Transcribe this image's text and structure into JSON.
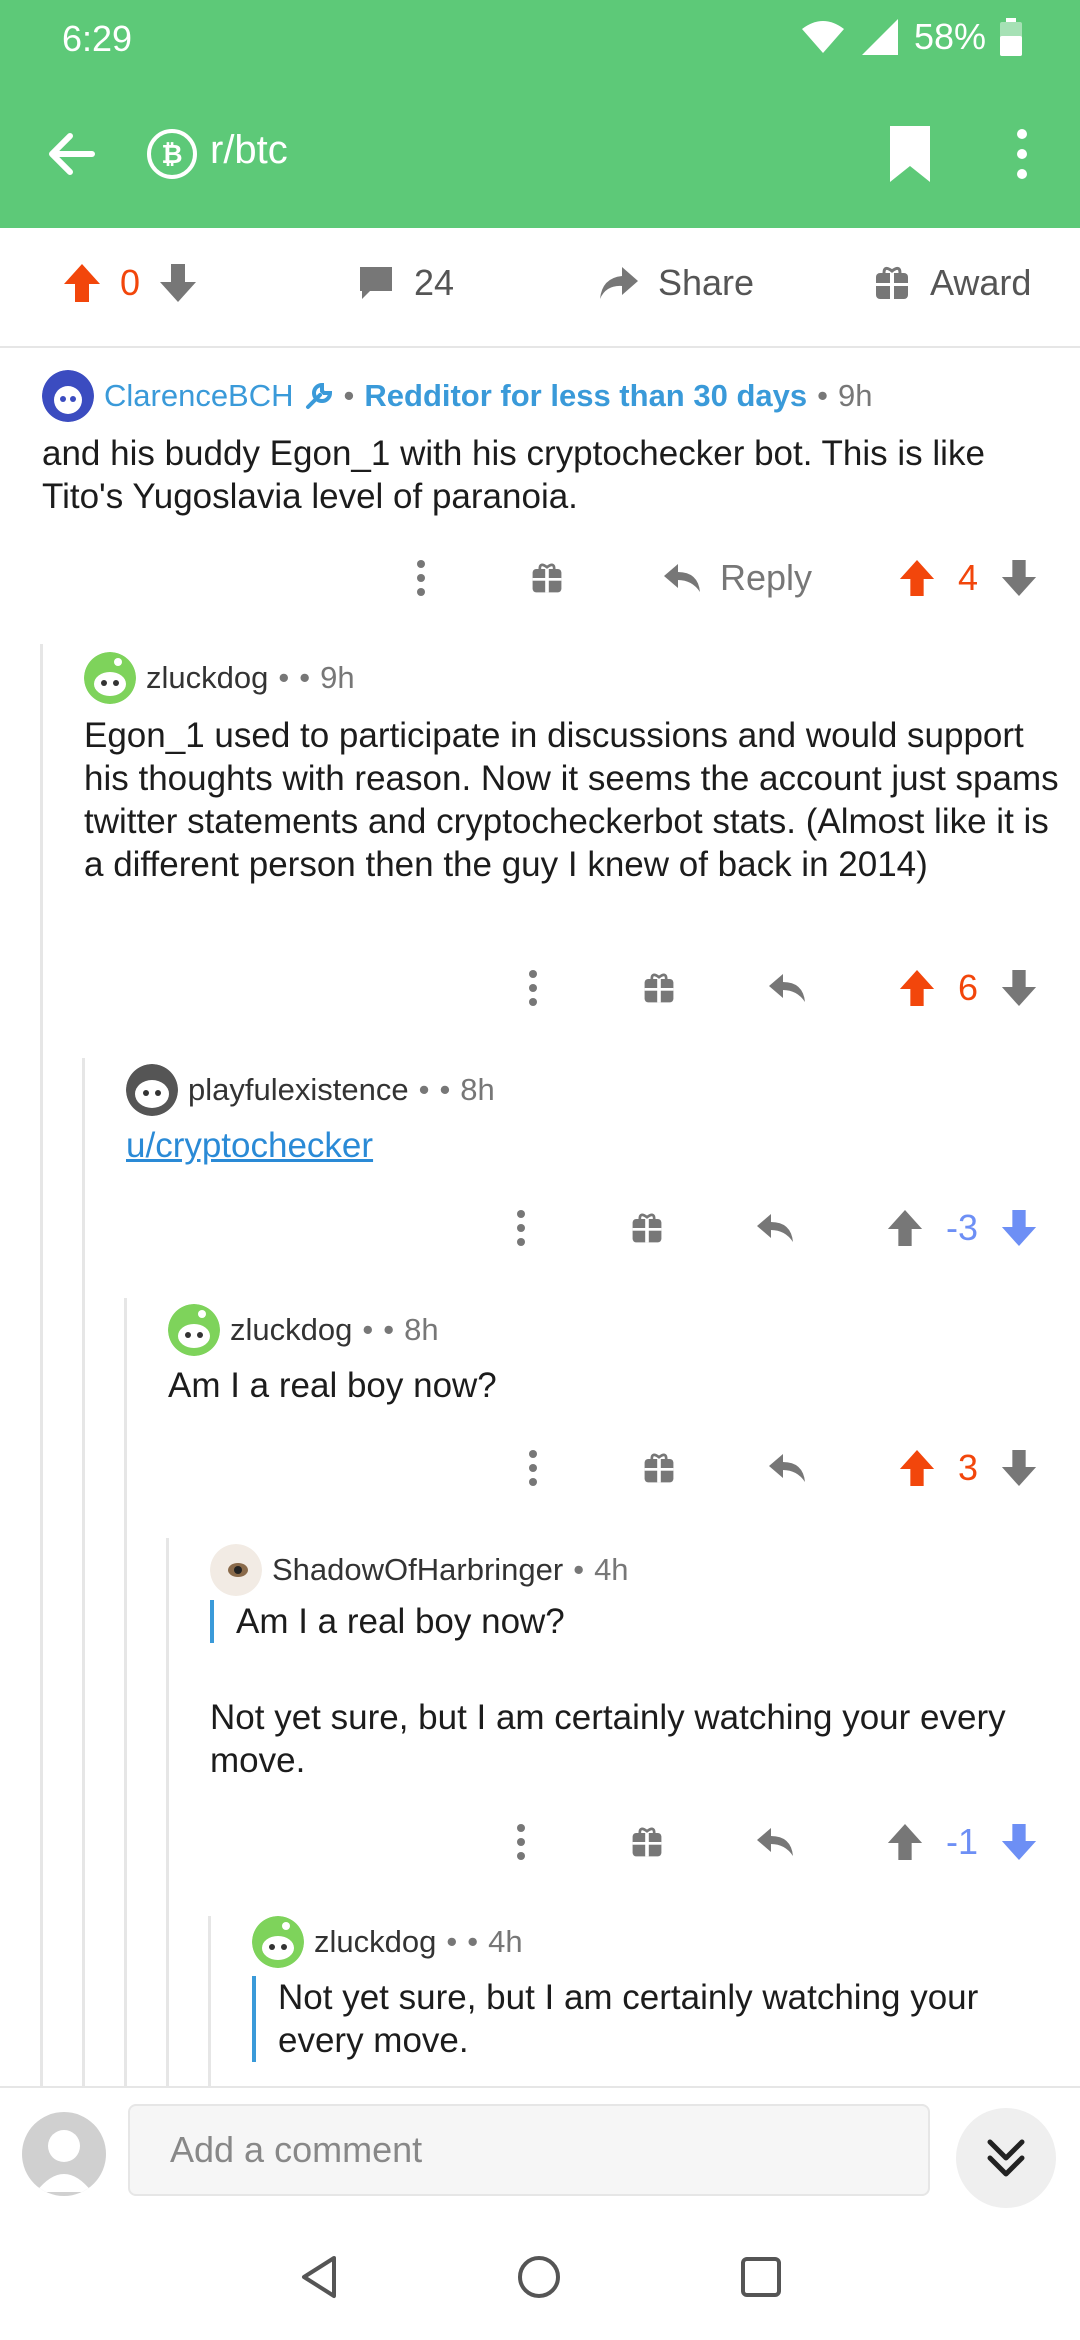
{
  "status": {
    "time": "6:29",
    "battery": "58%"
  },
  "appbar": {
    "subreddit": "r/btc"
  },
  "postbar": {
    "score": "0",
    "comments": "24",
    "share_label": "Share",
    "award_label": "Award"
  },
  "comments": [
    {
      "author": "ClarenceBCH",
      "flair": "Redditor for less than 30 days",
      "age": "9h",
      "body": "and his buddy Egon_1 with his cryptochecker bot. This is like Tito's Yugoslavia level of paranoia.",
      "reply_label": "Reply",
      "score": "4"
    },
    {
      "author": "zluckdog",
      "age": "9h",
      "body": "Egon_1 used to participate in discussions and would support his thoughts with reason. Now it seems the account just spams twitter statements and cryptocheckerbot stats.  (Almost like it is a different person then the guy I knew of back in 2014)",
      "score": "6"
    },
    {
      "author": "playfulexistence",
      "age": "8h",
      "link": "u/cryptochecker",
      "score": "-3"
    },
    {
      "author": "zluckdog",
      "age": "8h",
      "body": "Am I a real boy now?",
      "score": "3"
    },
    {
      "author": "ShadowOfHarbringer",
      "age": "4h",
      "quote": "Am I a real boy now?",
      "body": "Not yet sure, but I am certainly watching your every move.",
      "score": "-1"
    },
    {
      "author": "zluckdog",
      "age": "4h",
      "quote": "Not yet sure, but I am certainly watching your every move."
    }
  ],
  "composer": {
    "placeholder": "Add a comment"
  },
  "colors": {
    "header_green": "#5dc978",
    "upvote_orange": "#f2460b",
    "downvote_blue": "#6d8ff5",
    "flair_blue": "#3a9ad9"
  }
}
